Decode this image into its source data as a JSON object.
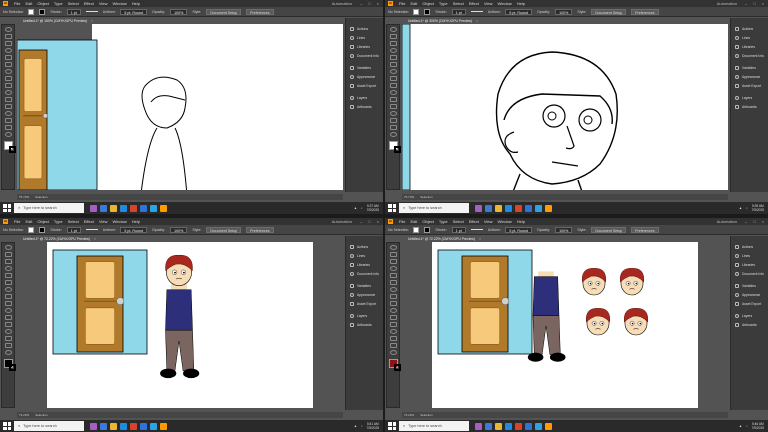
{
  "menu": [
    "File",
    "Edit",
    "Object",
    "Type",
    "Select",
    "Effect",
    "View",
    "Window",
    "Help"
  ],
  "workspace": "Automation",
  "ctrl": {
    "selection": "No Selection",
    "stroke_label": "Stroke:",
    "stroke_value": "1 pt",
    "brush": "Uniform",
    "brush_size": "5 pt. Round",
    "opacity_label": "Opacity:",
    "opacity_value": "100%",
    "style_label": "Style:",
    "doc_setup": "Document Setup",
    "preferences": "Preferences"
  },
  "panels": [
    "Actions",
    "Lines",
    "Libraries",
    "Document Info",
    "Variables",
    "Appearance",
    "Asset Export",
    "Layers",
    "Artboards"
  ],
  "taskbar": {
    "search_placeholder": "Type here to search"
  },
  "quads": [
    {
      "tab": "Untitled-1* @ 150% (CMYK/GPU Preview)",
      "time": "5:37 AM",
      "date": "7/5/2025",
      "fill_color": "#ffffff"
    },
    {
      "tab": "Untitled-1* @ 300% (CMYK/GPU Preview)",
      "time": "5:39 AM",
      "date": "7/5/2025",
      "fill_color": "#ffffff"
    },
    {
      "tab": "Untitled-1* @ 72.22% (CMYK/GPU Preview)",
      "time": "5:41 AM",
      "date": "7/5/2025",
      "fill_color": "#000000"
    },
    {
      "tab": "Untitled-1* @ 72.22% (CMYK/GPU Preview)",
      "time": "5:46 AM",
      "date": "7/5/2025",
      "fill_color": "#8b1414"
    }
  ],
  "status": {
    "zoom_a": "72.22%",
    "zoom_b": "75.72%",
    "tool": "Selection"
  },
  "colors": {
    "door": "#b07a2a",
    "door_panel": "#f7c97a",
    "wall": "#8ed8ea",
    "hair": "#a8281f",
    "shirt": "#2d2f7a",
    "pants": "#7a6560",
    "skin": "#f7dcb6"
  }
}
